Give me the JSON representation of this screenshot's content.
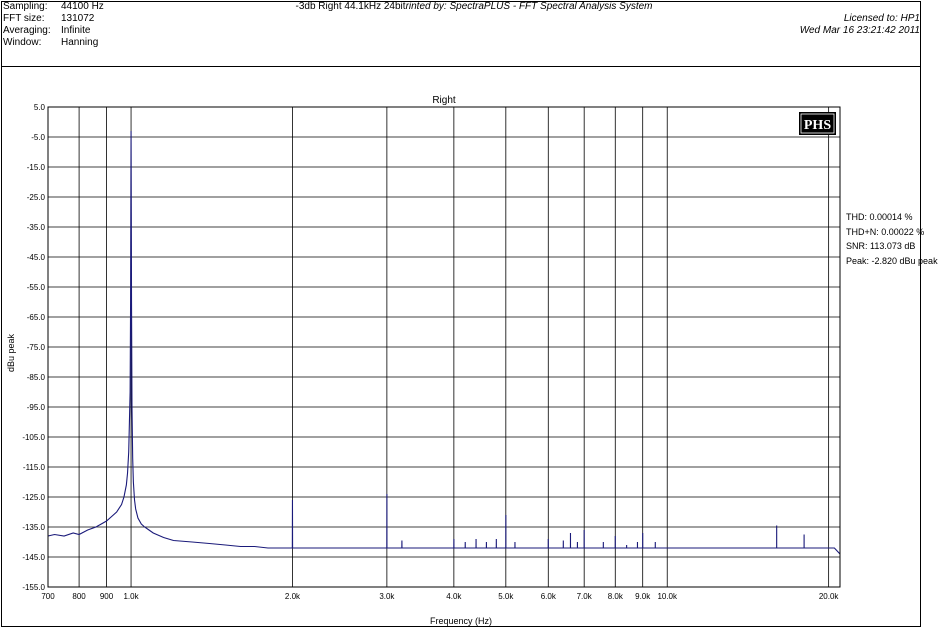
{
  "header": {
    "sampling_label": "Sampling:",
    "sampling_value": "44100 Hz",
    "fft_label": "FFT size:",
    "fft_value": "131072",
    "avg_label": "Averaging:",
    "avg_value": "Infinite",
    "window_label": "Window:",
    "window_value": "Hanning",
    "title_main": "-3db Right 44.1kHz 24bit",
    "title_sub": "rinted by: SpectraPLUS - FFT Spectral Analysis System",
    "licensed": "Licensed to: HP1",
    "timestamp": "Wed Mar 16 23:21:42 2011"
  },
  "logo_text": "PHS",
  "stats": {
    "thd": "THD: 0.00014 %",
    "thdn": "THD+N: 0.00022 %",
    "snr": "SNR: 113.073 dB",
    "peak": "Peak: -2.820 dBu peak"
  },
  "chart_data": {
    "type": "line",
    "title": "Right",
    "xlabel": "Frequency (Hz)",
    "ylabel": "dBu peak",
    "xscale": "log",
    "xlim": [
      700,
      21000
    ],
    "ylim": [
      -155,
      5
    ],
    "grid": true,
    "x_ticks": [
      700,
      800,
      900,
      1000,
      2000,
      3000,
      4000,
      5000,
      6000,
      7000,
      8000,
      9000,
      10000,
      20000
    ],
    "x_tick_labels": [
      "700",
      "800",
      "900",
      "1.0k",
      "2.0k",
      "3.0k",
      "4.0k",
      "5.0k",
      "6.0k",
      "7.0k",
      "8.0k",
      "9.0k",
      "10.0k",
      "20.0k"
    ],
    "y_ticks": [
      5,
      -5,
      -15,
      -25,
      -35,
      -45,
      -55,
      -65,
      -75,
      -85,
      -95,
      -105,
      -115,
      -125,
      -135,
      -145,
      -155
    ],
    "y_tick_labels": [
      "5.0",
      "-5.0",
      "-15.0",
      "-25.0",
      "-35.0",
      "-45.0",
      "-55.0",
      "-65.0",
      "-75.0",
      "-85.0",
      "-95.0",
      "-105.0",
      "-115.0",
      "-125.0",
      "-135.0",
      "-145.0",
      "-155.0"
    ],
    "series": [
      {
        "color": "#1a1a7a",
        "x": [
          700,
          720,
          750,
          780,
          800,
          830,
          860,
          880,
          900,
          920,
          940,
          960,
          970,
          980,
          985,
          990,
          993,
          996,
          998,
          999,
          1000,
          1001,
          1002,
          1004,
          1007,
          1010,
          1015,
          1020,
          1030,
          1045,
          1060,
          1080,
          1100,
          1150,
          1200,
          1300,
          1400,
          1500,
          1600,
          1700,
          1800,
          1900,
          1999,
          2000,
          2001,
          2200,
          2500,
          2800,
          2999,
          3000,
          3001,
          3100,
          3199,
          3200,
          3201,
          3500,
          3800,
          3999,
          4000,
          4001,
          4199,
          4200,
          4201,
          4399,
          4400,
          4401,
          4599,
          4600,
          4601,
          4799,
          4800,
          4801,
          4999,
          5000,
          5001,
          5199,
          5200,
          5201,
          5500,
          5800,
          5999,
          6000,
          6001,
          6399,
          6400,
          6401,
          6599,
          6600,
          6601,
          6799,
          6800,
          6801,
          6999,
          7000,
          7001,
          7599,
          7600,
          7601,
          7999,
          8000,
          8001,
          8399,
          8400,
          8401,
          8799,
          8800,
          8801,
          8999,
          9000,
          9001,
          9499,
          9500,
          9501,
          10000,
          11000,
          12000,
          13000,
          14000,
          15000,
          15999,
          16000,
          16001,
          17000,
          17999,
          18000,
          18001,
          19000,
          20000,
          20500,
          21000
        ],
        "y": [
          -138,
          -137.5,
          -138,
          -137,
          -137.5,
          -136,
          -135,
          -134,
          -133,
          -131.5,
          -130,
          -127.5,
          -125,
          -121,
          -117,
          -110,
          -100,
          -90,
          -60,
          -30,
          -3,
          -30,
          -60,
          -95,
          -112,
          -120,
          -126,
          -129,
          -132,
          -134,
          -135,
          -136,
          -137,
          -138.5,
          -139.5,
          -140,
          -140.5,
          -141,
          -141.5,
          -141.5,
          -142,
          -142,
          -142,
          -126,
          -142,
          -142,
          -142,
          -142,
          -142,
          -124,
          -142,
          -142,
          -142,
          -139.5,
          -142,
          -142,
          -142,
          -142,
          -139,
          -142,
          -142,
          -140,
          -142,
          -142,
          -139,
          -142,
          -142,
          -140,
          -142,
          -142,
          -139,
          -142,
          -142,
          -131,
          -142,
          -142,
          -140,
          -142,
          -142,
          -142,
          -142,
          -139,
          -142,
          -142,
          -139.5,
          -142,
          -142,
          -137,
          -142,
          -142,
          -140,
          -142,
          -142,
          -136,
          -142,
          -142,
          -140,
          -142,
          -142,
          -138,
          -142,
          -142,
          -141,
          -142,
          -142,
          -140,
          -142,
          -142,
          -137,
          -142,
          -142,
          -140,
          -142,
          -142,
          -142,
          -142,
          -142,
          -142,
          -142,
          -142,
          -134.5,
          -142,
          -142,
          -142,
          -137.5,
          -142,
          -142,
          -142,
          -142,
          -144
        ]
      }
    ]
  }
}
